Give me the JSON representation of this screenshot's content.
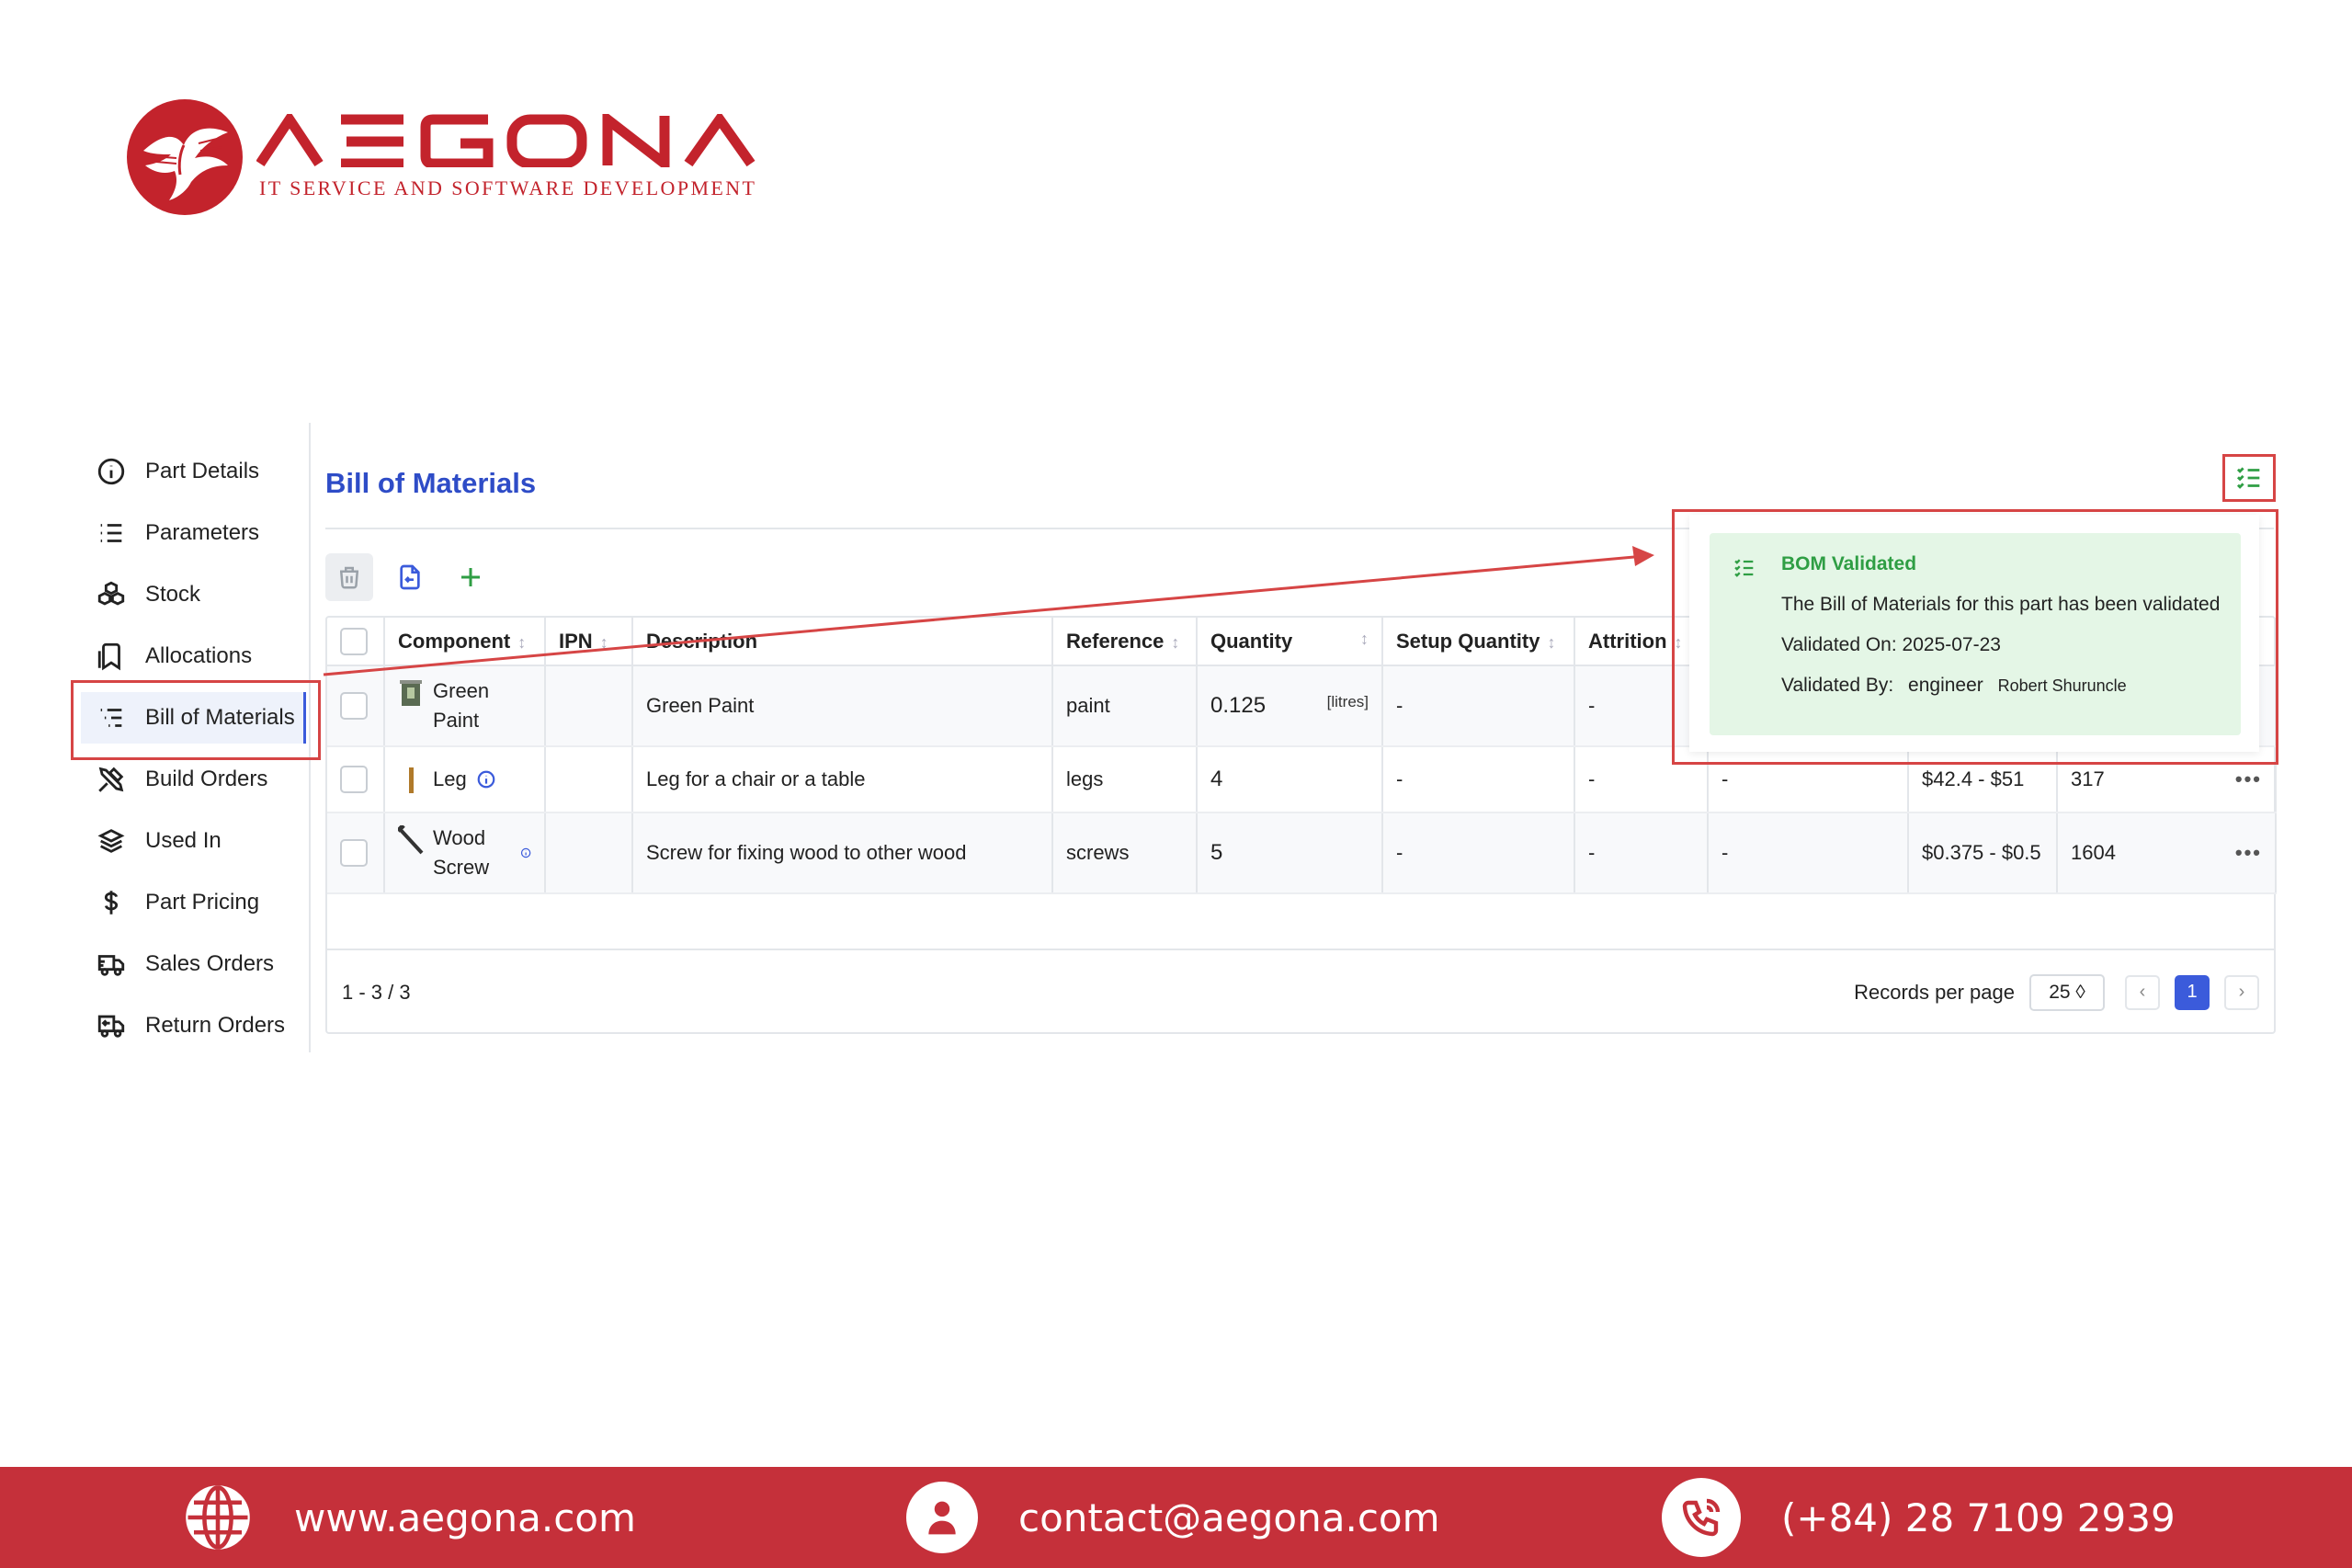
{
  "brand": {
    "name": "AEGONA",
    "tagline": "IT SERVICE AND SOFTWARE DEVELOPMENT",
    "color": "#c3232c"
  },
  "sidebar": {
    "items": [
      {
        "label": "Part Details",
        "icon": "info-circle-icon"
      },
      {
        "label": "Parameters",
        "icon": "list-icon"
      },
      {
        "label": "Stock",
        "icon": "boxes-icon"
      },
      {
        "label": "Allocations",
        "icon": "bookmark-icon"
      },
      {
        "label": "Bill of Materials",
        "icon": "list-tree-icon",
        "active": true
      },
      {
        "label": "Build Orders",
        "icon": "tools-icon"
      },
      {
        "label": "Used In",
        "icon": "stack-icon"
      },
      {
        "label": "Part Pricing",
        "icon": "currency-dollar-icon"
      },
      {
        "label": "Sales Orders",
        "icon": "truck-delivery-icon"
      },
      {
        "label": "Return Orders",
        "icon": "truck-return-icon"
      }
    ]
  },
  "main": {
    "title": "Bill of Materials",
    "accent": "#2e4cc7"
  },
  "table": {
    "headers": {
      "component": "Component",
      "ipn": "IPN",
      "description": "Description",
      "reference": "Reference",
      "quantity": "Quantity",
      "setup_quantity": "Setup Quantity",
      "attrition": "Attrition"
    },
    "rows": [
      {
        "component": "Green Paint",
        "ipn": "",
        "description": "Green Paint",
        "reference": "paint",
        "quantity": "0.125",
        "unit": "[litres]",
        "setup_quantity": "-",
        "attrition": "-",
        "col8": "",
        "price": "",
        "stock": ""
      },
      {
        "component": "Leg",
        "ipn": "",
        "description": "Leg for a chair or a table",
        "reference": "legs",
        "quantity": "4",
        "unit": "",
        "setup_quantity": "-",
        "attrition": "-",
        "col8": "-",
        "price": "$42.4 - $51",
        "stock": "317"
      },
      {
        "component": "Wood Screw",
        "ipn": "",
        "description": "Screw for fixing wood to other wood",
        "reference": "screws",
        "quantity": "5",
        "unit": "",
        "setup_quantity": "-",
        "attrition": "-",
        "col8": "-",
        "price": "$0.375 - $0.5",
        "stock": "1604"
      }
    ],
    "row_menu": "•••"
  },
  "pagination": {
    "range": "1 - 3 / 3",
    "records_label": "Records per page",
    "records_value": "25 ◊",
    "prev": "‹",
    "current": "1",
    "next": "›"
  },
  "popover": {
    "title": "BOM Validated",
    "message": "The Bill of Materials for this part has been validated",
    "validated_on": "Validated On: 2025-07-23",
    "validated_by_label": "Validated By:",
    "validated_by_user": "engineer",
    "validated_by_name": "Robert Shuruncle",
    "color": "#2f9e44"
  },
  "footer": {
    "website": "www.aegona.com",
    "email": "contact@aegona.com",
    "phone": "(+84) 28 7109 2939",
    "color": "#c5303a"
  }
}
